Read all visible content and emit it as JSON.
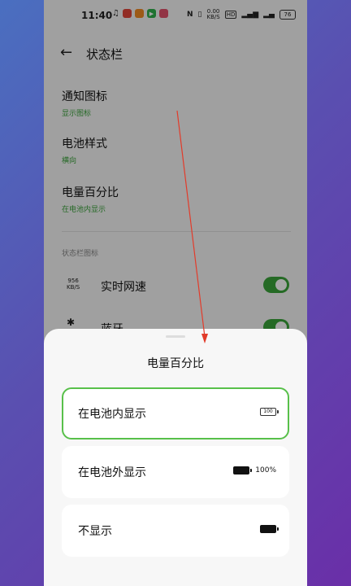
{
  "statusbar": {
    "time": "11:40",
    "net_speed": "0.00\nKB/S",
    "net_speed_top": "0.00",
    "net_speed_bottom": "KB/S",
    "signal_label": "HD",
    "battery": "76"
  },
  "header": {
    "back_icon": "back-arrow-icon",
    "title": "状态栏"
  },
  "settings": [
    {
      "title": "通知图标",
      "subtitle": "显示图标"
    },
    {
      "title": "电池样式",
      "subtitle": "横向"
    },
    {
      "title": "电量百分比",
      "subtitle": "在电池内显示"
    }
  ],
  "section_label": "状态栏图标",
  "toggles": [
    {
      "icon_top": "956",
      "icon_bottom": "KB/S",
      "label": "实时网速",
      "on": true
    },
    {
      "icon_glyph": "✱",
      "label": "蓝牙",
      "on": true
    }
  ],
  "sheet": {
    "title": "电量百分比",
    "options": [
      {
        "label": "在电池内显示",
        "preview_text": "100",
        "selected": true
      },
      {
        "label": "在电池外显示",
        "preview_text": "100%",
        "selected": false
      },
      {
        "label": "不显示",
        "preview_text": "",
        "selected": false
      }
    ]
  },
  "colors": {
    "accent": "#3aa33a",
    "selected_border": "#58c04a",
    "annotation_line": "#e23b2a"
  }
}
